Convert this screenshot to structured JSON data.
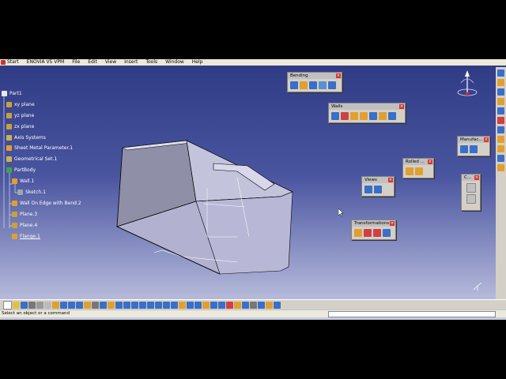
{
  "menu": [
    "Start",
    "ENOVIA V5 VPM",
    "File",
    "Edit",
    "View",
    "Insert",
    "Tools",
    "Window",
    "Help"
  ],
  "tree": [
    {
      "label": "Part1",
      "icon": "part-icon",
      "color": "#e8e8e8"
    },
    {
      "label": "xy plane",
      "icon": "plane-icon",
      "color": "#c9a13a"
    },
    {
      "label": "yz plane",
      "icon": "plane-icon",
      "color": "#c9a13a"
    },
    {
      "label": "zx plane",
      "icon": "plane-icon",
      "color": "#c9a13a"
    },
    {
      "label": "Axis Systems",
      "icon": "axis-icon",
      "color": "#d0b050"
    },
    {
      "label": "Sheet Metal Parameter.1",
      "icon": "sheet-metal-icon",
      "color": "#e0a030"
    },
    {
      "label": "Geometrical Set.1",
      "icon": "geometrical-set-icon",
      "color": "#d0b050"
    },
    {
      "label": "PartBody",
      "icon": "body-icon",
      "color": "#3fa34d"
    },
    {
      "label": "Wall.1",
      "icon": "wall-icon",
      "color": "#e0a030"
    },
    {
      "label": "Sketch.1",
      "icon": "sketch-icon",
      "color": "#9aa"
    },
    {
      "label": "Wall On Edge with Bend.2",
      "icon": "wall-edge-icon",
      "color": "#e0a030"
    },
    {
      "label": "Plane.3",
      "icon": "plane-icon",
      "color": "#c9a13a"
    },
    {
      "label": "Plane.4",
      "icon": "plane-icon",
      "color": "#c9a13a"
    },
    {
      "label": "Flange.1",
      "icon": "flange-icon",
      "color": "#e0a030"
    }
  ],
  "toolboxes": {
    "bending": {
      "title": "Bending"
    },
    "walls": {
      "title": "Walls"
    },
    "rolled": {
      "title": "Rolled ..."
    },
    "views": {
      "title": "Views"
    },
    "transformations": {
      "title": "Transformations"
    },
    "manufacturing": {
      "title": "Manufac..."
    },
    "constraints": {
      "title": "C..."
    }
  },
  "status": {
    "text": "Select an object or a command"
  }
}
